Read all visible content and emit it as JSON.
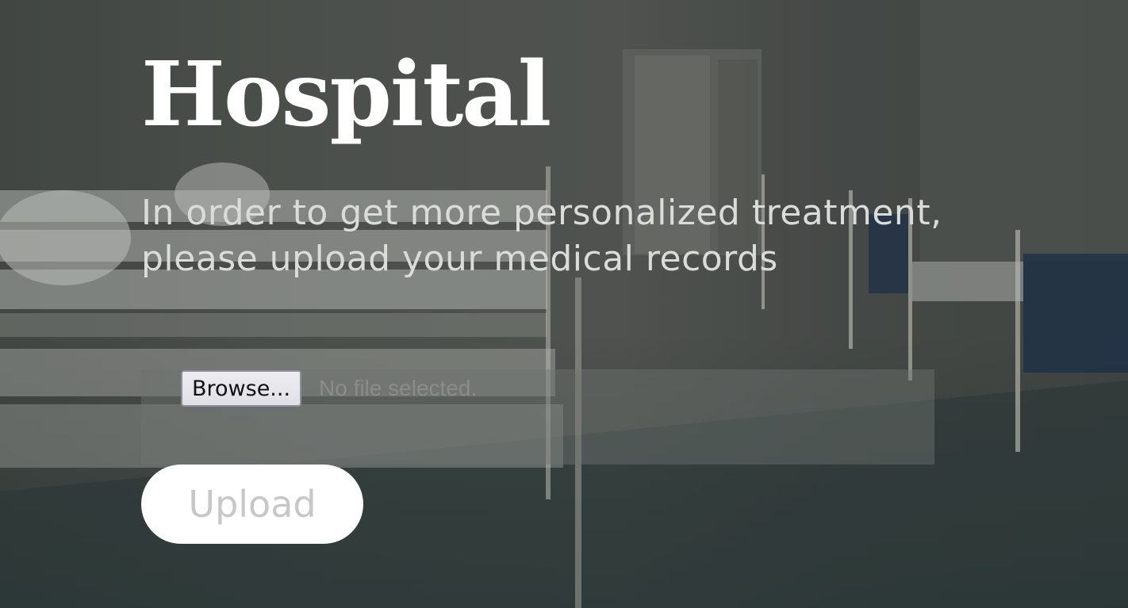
{
  "page": {
    "title": "Hospital",
    "subtitle": "In order to get more personalized treatment, please upload your medical records"
  },
  "upload_form": {
    "browse_label": "Browse...",
    "file_status": "No file selected.",
    "upload_label": "Upload"
  },
  "colors": {
    "title": "#ffffff",
    "subtitle": "#d9dcdb",
    "upload_button_bg": "#ffffff",
    "upload_button_text": "#c7c7c7"
  },
  "background": {
    "icon": "hospital-ward-photo"
  }
}
